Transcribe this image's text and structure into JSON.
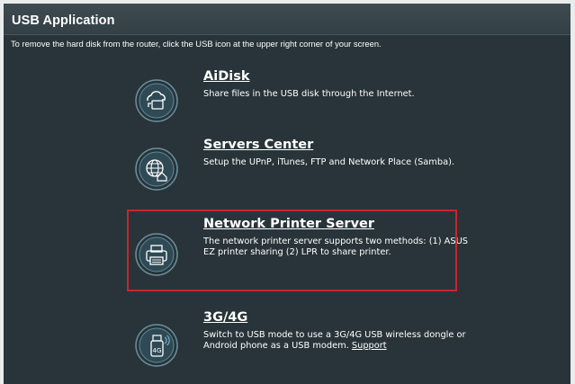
{
  "panel": {
    "title": "USB Application",
    "instruction": "To remove the hard disk from the router, click the USB icon at the upper right corner of your screen."
  },
  "features": [
    {
      "title": "AiDisk",
      "description": "Share files in the USB disk through the Internet.",
      "icon": "cloud-computer-icon"
    },
    {
      "title": "Servers Center",
      "description": "Setup the UPnP, iTunes, FTP and Network Place (Samba).",
      "icon": "globe-server-icon"
    },
    {
      "title": "Network Printer Server",
      "description": "The network printer server supports two methods: (1) ASUS EZ printer sharing (2) LPR to share printer.",
      "icon": "printer-icon",
      "highlighted": true
    },
    {
      "title": "3G/4G",
      "description": "Switch to USB mode to use a 3G/4G USB wireless dongle or Android phone as a USB modem.",
      "link": "Support",
      "icon": "usb-dongle-4g-icon"
    }
  ],
  "colors": {
    "panel_bg": "#283439",
    "header_bg": "#334045",
    "text": "#ffffff",
    "highlight_border": "#c7262c",
    "icon_stroke": "#7fb6cf"
  }
}
